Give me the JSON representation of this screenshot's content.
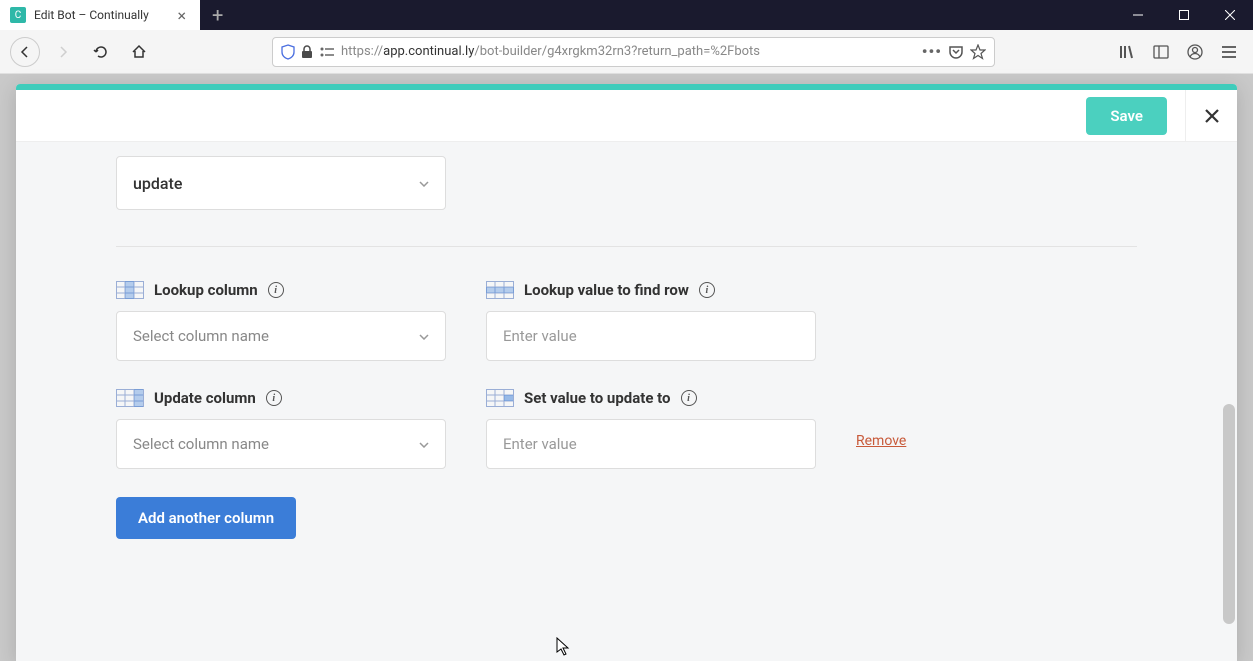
{
  "browser": {
    "tab_title": "Edit Bot – Continually",
    "url_protocol": "https://",
    "url_domain": "app.continual.ly",
    "url_path": "/bot-builder/g4xrgkm32rn3?return_path=%2Fbots"
  },
  "modal": {
    "save_label": "Save",
    "action_value": "update",
    "lookup_column": {
      "label": "Lookup column",
      "placeholder": "Select column name"
    },
    "lookup_value": {
      "label": "Lookup value to find row",
      "placeholder": "Enter value"
    },
    "update_column": {
      "label": "Update column",
      "placeholder": "Select column name"
    },
    "set_value": {
      "label": "Set value to update to",
      "placeholder": "Enter value"
    },
    "remove_label": "Remove",
    "add_column_label": "Add another column"
  }
}
